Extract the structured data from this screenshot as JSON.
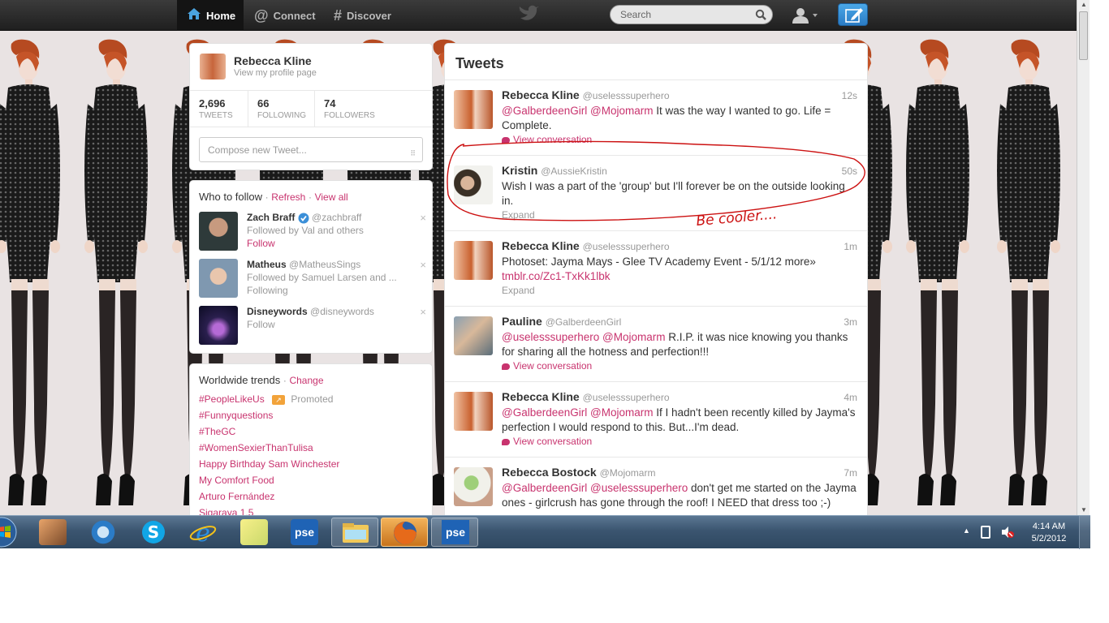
{
  "nav": {
    "home_label": "Home",
    "connect_label": "Connect",
    "discover_label": "Discover",
    "search_placeholder": "Search",
    "icons": {
      "home": "home-icon",
      "connect": "at-sign-icon",
      "discover": "hash-icon",
      "logo": "twitter-bird-icon",
      "search": "search-icon",
      "user": "user-icon",
      "compose": "compose-pen-icon"
    },
    "compose_color": "#3b8fd8"
  },
  "profile": {
    "name": "Rebecca Kline",
    "link_text": "View my profile page",
    "stats": [
      {
        "num": "2,696",
        "label": "TWEETS"
      },
      {
        "num": "66",
        "label": "FOLLOWING"
      },
      {
        "num": "74",
        "label": "FOLLOWERS"
      }
    ],
    "compose_placeholder": "Compose new Tweet..."
  },
  "who_to_follow": {
    "title": "Who to follow",
    "sep": "·",
    "refresh": "Refresh",
    "view_all": "View all",
    "items": [
      {
        "name": "Zach Braff",
        "handle": "@zachbraff",
        "line2": "Followed by Val and others",
        "line3": "Follow",
        "verified": true
      },
      {
        "name": "Matheus",
        "handle": "@MatheusSings",
        "line2": "Followed by Samuel Larsen and ...",
        "line3": "Following",
        "verified": false
      },
      {
        "name": "Disneywords",
        "handle": "@disneywords",
        "line2": "",
        "line3": "Follow",
        "verified": false
      }
    ],
    "dismiss": "×"
  },
  "trends": {
    "title": "Worldwide trends",
    "sep": "·",
    "change": "Change",
    "promoted_label": "Promoted",
    "items": [
      "#PeopleLikeUs",
      "#Funnyquestions",
      "#TheGC",
      "#WomenSexierThanTulisa",
      "Happy Birthday Sam Winchester",
      "My Comfort Food",
      "Arturo Fernández",
      "Sigaraya 1,5"
    ]
  },
  "stream": {
    "title": "Tweets",
    "tweets": [
      {
        "name": "Rebecca Kline",
        "handle": "@uselesssuperhero",
        "time": "12s",
        "text_mention": "@GalberdeenGirl @Mojomarm",
        "text": " It was the way I wanted to go. Life = Complete.",
        "action": "View conversation"
      },
      {
        "name": "Kristin",
        "handle": "@AussieKristin",
        "time": "50s",
        "text_mention": "",
        "text": "Wish I was a part of the 'group' but I'll forever be on the outside looking in.",
        "action": "Expand"
      },
      {
        "name": "Rebecca Kline",
        "handle": "@uselesssuperhero",
        "time": "1m",
        "text_mention": "",
        "text": "Photoset: Jayma Mays - Glee TV Academy Event - 5/1/12 more»",
        "link": "tmblr.co/Zc1-TxKk1lbk",
        "action": "Expand"
      },
      {
        "name": "Pauline",
        "handle": "@GalberdeenGirl",
        "time": "3m",
        "text_mention": "@uselesssuperhero @Mojomarm",
        "text": " R.I.P. it was nice knowing you thanks for sharing all the hotness and perfection!!!",
        "action": "View conversation"
      },
      {
        "name": "Rebecca Kline",
        "handle": "@uselesssuperhero",
        "time": "4m",
        "text_mention": "@GalberdeenGirl @Mojomarm",
        "text": " If I hadn't been recently killed by Jayma's perfection I would respond to this. But...I'm dead.",
        "action": "View conversation"
      },
      {
        "name": "Rebecca Bostock",
        "handle": "@Mojomarm",
        "time": "7m",
        "text_mention": "@GalberdeenGirl @uselesssuperhero",
        "text": " don't get me started on the Jayma ones - girlcrush has gone through the roof! I NEED that dress too ;-)",
        "action": ""
      }
    ]
  },
  "annotation": {
    "text": "Be cooler....",
    "color": "#cc1111"
  },
  "taskbar": {
    "time": "4:14 AM",
    "date": "5/2/2012",
    "apps": [
      "start-orb-icon",
      "app-icon",
      "sync-icon",
      "skype-icon",
      "ie-icon",
      "stickynotes-icon",
      "pse-icon",
      "explorer-icon",
      "firefox-icon",
      "pse-icon"
    ],
    "pse_label": "pse"
  },
  "accent_color": "#c8336e"
}
